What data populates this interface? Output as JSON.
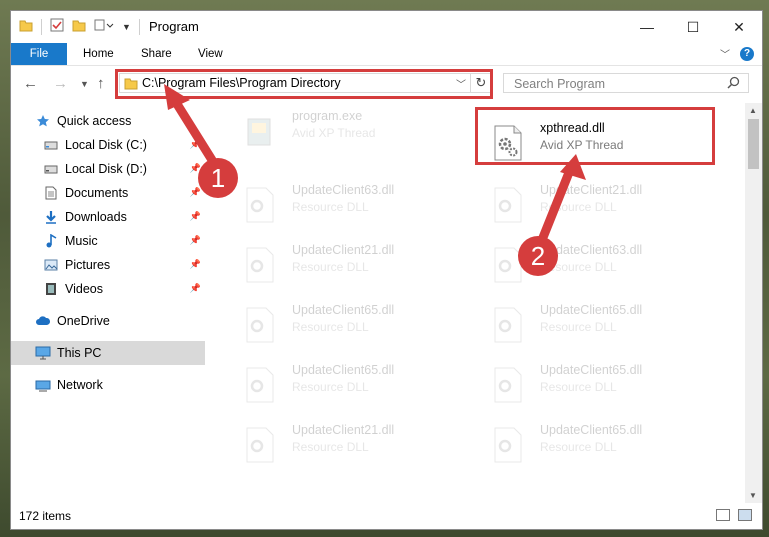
{
  "window": {
    "title": "Program",
    "controls": {
      "minimize": "—",
      "maximize": "☐",
      "close": "✕"
    }
  },
  "ribbon": {
    "tabs": [
      {
        "label": "File"
      },
      {
        "label": "Home"
      },
      {
        "label": "Share"
      },
      {
        "label": "View"
      }
    ],
    "help": "?"
  },
  "nav": {
    "address": "C:\\Program Files\\Program Directory",
    "search_placeholder": "Search Program"
  },
  "sidebar": {
    "items": [
      {
        "label": "Quick access",
        "icon": "star-icon"
      },
      {
        "label": "Local Disk (C:)",
        "icon": "drive-icon",
        "pinned": true
      },
      {
        "label": "Local Disk (D:)",
        "icon": "drive-icon",
        "pinned": true
      },
      {
        "label": "Documents",
        "icon": "documents-icon",
        "pinned": true
      },
      {
        "label": "Downloads",
        "icon": "download-icon",
        "pinned": true
      },
      {
        "label": "Music",
        "icon": "music-icon",
        "pinned": true
      },
      {
        "label": "Pictures",
        "icon": "pictures-icon",
        "pinned": true
      },
      {
        "label": "Videos",
        "icon": "videos-icon",
        "pinned": true
      },
      {
        "label": "OneDrive",
        "icon": "cloud-icon"
      },
      {
        "label": "This PC",
        "icon": "computer-icon",
        "selected": true
      },
      {
        "label": "Network",
        "icon": "network-icon"
      }
    ]
  },
  "files": {
    "items": [
      {
        "name": "program.exe",
        "desc": "Avid XP Thread",
        "faded": true
      },
      {
        "name": "xpthread.dll",
        "desc": "Avid XP Thread",
        "faded": false
      },
      {
        "name": "UpdateClient63.dll",
        "desc": "Resource DLL",
        "faded": true
      },
      {
        "name": "UpdateClient21.dll",
        "desc": "Resource DLL",
        "faded": true
      },
      {
        "name": "UpdateClient21.dll",
        "desc": "Resource DLL",
        "faded": true
      },
      {
        "name": "UpdateClient63.dll",
        "desc": "Resource DLL",
        "faded": true
      },
      {
        "name": "UpdateClient65.dll",
        "desc": "Resource DLL",
        "faded": true
      },
      {
        "name": "UpdateClient65.dll",
        "desc": "Resource DLL",
        "faded": true
      },
      {
        "name": "UpdateClient65.dll",
        "desc": "Resource DLL",
        "faded": true
      },
      {
        "name": "UpdateClient65.dll",
        "desc": "Resource DLL",
        "faded": true
      },
      {
        "name": "UpdateClient21.dll",
        "desc": "Resource DLL",
        "faded": true
      },
      {
        "name": "UpdateClient65.dll",
        "desc": "Resource DLL",
        "faded": true
      }
    ]
  },
  "status": {
    "count": "172 items"
  },
  "annotations": {
    "step1": "1",
    "step2": "2",
    "color": "#d53d3d"
  }
}
